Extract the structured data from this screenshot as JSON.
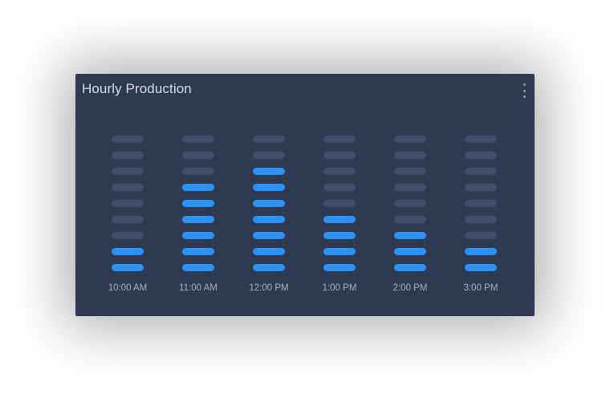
{
  "widget": {
    "title": "Hourly Production",
    "menu_icon": "vertical-ellipsis-icon"
  },
  "colors": {
    "card_background": "#2e3a52",
    "segment_active": "#2b92f8",
    "segment_inactive": "#424e68",
    "tick_text": "#a9b1c1"
  },
  "chart_data": {
    "type": "bar",
    "style": "segmented-led",
    "categories": [
      "10:00 AM",
      "11:00 AM",
      "12:00 PM",
      "1:00 PM",
      "2:00 PM",
      "3:00 PM"
    ],
    "values": [
      2,
      6,
      7,
      4,
      3,
      2
    ],
    "segments_per_bar": 9,
    "ylim": [
      0,
      9
    ],
    "title": "Hourly Production",
    "xlabel": "",
    "ylabel": "",
    "grid": false,
    "legend": "none"
  }
}
